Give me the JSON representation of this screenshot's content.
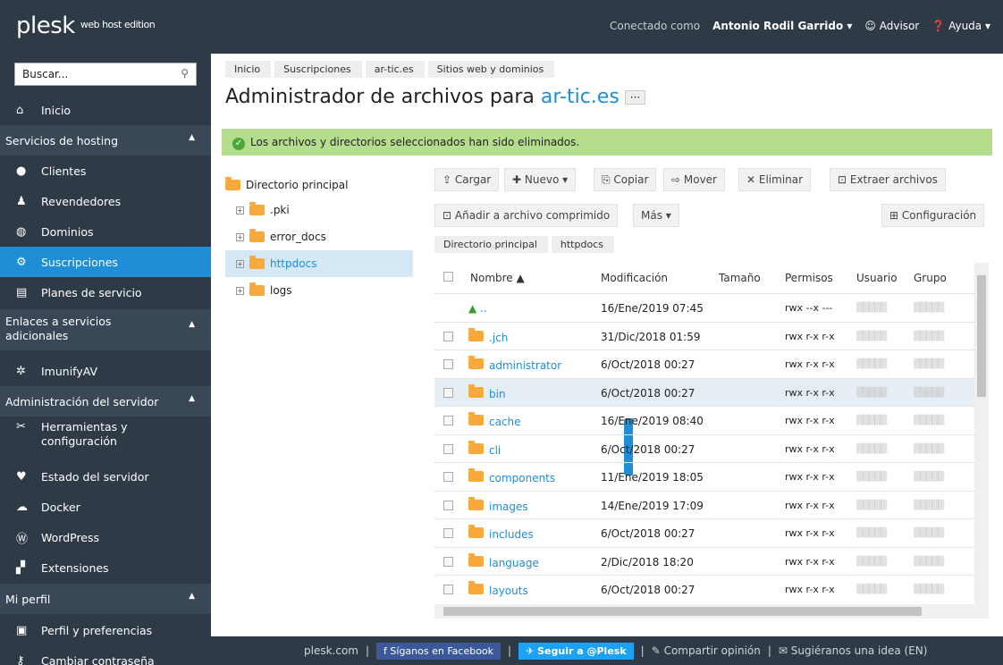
{
  "header": {
    "logo": "plesk",
    "edition": "web host edition",
    "connected_as": "Conectado como",
    "user": "Antonio Rodil Garrido ▾",
    "advisor": "Advisor",
    "help": "Ayuda ▾"
  },
  "sidebar": {
    "search_placeholder": "Buscar...",
    "inicio": "Inicio",
    "sec_hosting": "Servicios de hosting",
    "clientes": "Clientes",
    "revendedores": "Revendedores",
    "dominios": "Dominios",
    "suscripciones": "Suscripciones",
    "planes": "Planes de servicio",
    "sec_enlaces": "Enlaces a servicios adicionales",
    "imunify": "ImunifyAV",
    "sec_admin": "Administración del servidor",
    "herramientas": "Herramientas y configuración",
    "estado": "Estado del servidor",
    "docker": "Docker",
    "wordpress": "WordPress",
    "extensiones": "Extensiones",
    "sec_perfil": "Mi perfil",
    "perfil": "Perfil y preferencias",
    "contrasena": "Cambiar contraseña"
  },
  "breadcrumb": [
    "Inicio",
    "Suscripciones",
    "ar-tic.es",
    "Sitios web y dominios"
  ],
  "title": {
    "prefix": "Administrador de archivos para",
    "domain": "ar-tic.es",
    "more": "···"
  },
  "alert": "Los archivos y directorios seleccionados han sido eliminados.",
  "tree": {
    "root": "Directorio principal",
    "items": [
      ".pki",
      "error_docs",
      "httpdocs",
      "logs"
    ]
  },
  "toolbar": {
    "cargar": "Cargar",
    "nuevo": "Nuevo ▾",
    "copiar": "Copiar",
    "mover": "Mover",
    "eliminar": "Eliminar",
    "extraer": "Extraer archivos",
    "anadir": "Añadir a archivo comprimido",
    "mas": "Más ▾",
    "config": "Configuración"
  },
  "path": [
    "Directorio principal",
    "httpdocs"
  ],
  "columns": {
    "nombre": "Nombre ▲",
    "mod": "Modificación",
    "tam": "Tamaño",
    "perm": "Permisos",
    "usr": "Usuario",
    "grp": "Grupo"
  },
  "rows": [
    {
      "name": "..",
      "mod": "16/Ene/2019 07:45",
      "perm": "rwx --x ---"
    },
    {
      "name": ".jch",
      "mod": "31/Dic/2018 01:59",
      "perm": "rwx r-x r-x"
    },
    {
      "name": "administrator",
      "mod": "6/Oct/2018 00:27",
      "perm": "rwx r-x r-x"
    },
    {
      "name": "bin",
      "mod": "6/Oct/2018 00:27",
      "perm": "rwx r-x r-x"
    },
    {
      "name": "cache",
      "mod": "16/Ene/2019 08:40",
      "perm": "rwx r-x r-x"
    },
    {
      "name": "cli",
      "mod": "6/Oct/2018 00:27",
      "perm": "rwx r-x r-x"
    },
    {
      "name": "components",
      "mod": "11/Ene/2019 18:05",
      "perm": "rwx r-x r-x"
    },
    {
      "name": "images",
      "mod": "14/Ene/2019 17:09",
      "perm": "rwx r-x r-x"
    },
    {
      "name": "includes",
      "mod": "6/Oct/2018 00:27",
      "perm": "rwx r-x r-x"
    },
    {
      "name": "language",
      "mod": "2/Dic/2018 18:20",
      "perm": "rwx r-x r-x"
    },
    {
      "name": "layouts",
      "mod": "6/Oct/2018 00:27",
      "perm": "rwx r-x r-x"
    }
  ],
  "footer": {
    "site": "plesk.com",
    "fb": "Síganos en Facebook",
    "tw": "Seguir a @Plesk",
    "opinion": "Compartir opinión",
    "idea": "Sugiéranos una idea (EN)",
    "sep": "|"
  }
}
